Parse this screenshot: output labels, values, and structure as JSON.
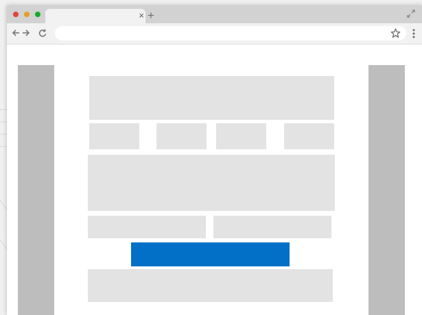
{
  "browser": {
    "window_controls": [
      "close",
      "minimize",
      "zoom"
    ],
    "tab": {
      "title": "",
      "close_glyph": "×"
    },
    "new_tab_glyph": "+",
    "toolbar": {
      "back_icon": "back-arrow-icon",
      "forward_icon": "forward-arrow-icon",
      "reload_icon": "reload-icon",
      "address_value": "",
      "address_placeholder": "",
      "bookmark_icon": "star-icon",
      "menu_icon": "kebab-menu-icon"
    },
    "maximize_icon": "expand-icon"
  },
  "colors": {
    "titlebar": "#d2d2d2",
    "tab": "#f2f2f2",
    "close_dot": "#e0443e",
    "minimize_dot": "#dea123",
    "zoom_dot": "#1aab29",
    "placeholder_block": "#e3e3e3",
    "sidebar": "#bdbdbd",
    "primary_button": "#0270c6"
  }
}
